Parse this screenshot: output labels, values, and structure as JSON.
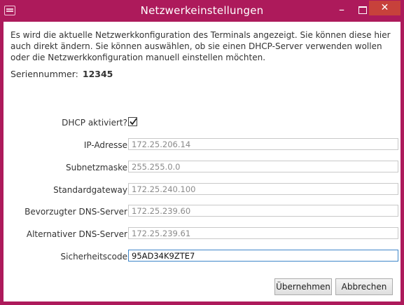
{
  "window": {
    "title": "Netzwerkeinstellungen",
    "minimize_glyph": "–",
    "close_glyph": "✕",
    "accent_color": "#ad1a5b",
    "close_color": "#c7413b"
  },
  "description": "Es wird die aktuelle Netzwerkkonfiguration des Terminals angezeigt. Sie können diese hier auch direkt ändern. Sie können auswählen, ob sie einen DHCP-Server verwenden wollen oder die Netzwerkkonfiguration manuell einstellen möchten.",
  "serial": {
    "label": "Seriennummer:",
    "value": "12345"
  },
  "form": {
    "dhcp_label": "DHCP aktiviert?",
    "dhcp_checked": true,
    "fields": [
      {
        "label": "IP-Adresse",
        "value": "172.25.206.14"
      },
      {
        "label": "Subnetzmaske",
        "value": "255.255.0.0"
      },
      {
        "label": "Standardgateway",
        "value": "172.25.240.100"
      },
      {
        "label": "Bevorzugter DNS-Server",
        "value": "172.25.239.60"
      },
      {
        "label": "Alternativer DNS-Server",
        "value": "172.25.239.61"
      },
      {
        "label": "Sicherheitscode",
        "value": "95AD34K9ZTE7"
      }
    ]
  },
  "buttons": {
    "ok": "Übernehmen",
    "cancel": "Abbrechen"
  }
}
